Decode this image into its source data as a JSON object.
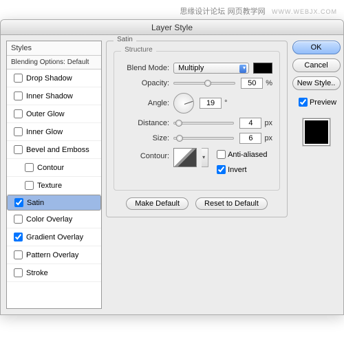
{
  "watermark": {
    "cn": "思缘设计论坛",
    "url": "WWW.WEBJX.COM",
    "site": "网页教学网"
  },
  "title": "Layer Style",
  "sidebar": {
    "header": "Styles",
    "subheader": "Blending Options: Default",
    "items": [
      {
        "label": "Drop Shadow",
        "checked": false,
        "indent": false,
        "selected": false
      },
      {
        "label": "Inner Shadow",
        "checked": false,
        "indent": false,
        "selected": false
      },
      {
        "label": "Outer Glow",
        "checked": false,
        "indent": false,
        "selected": false
      },
      {
        "label": "Inner Glow",
        "checked": false,
        "indent": false,
        "selected": false
      },
      {
        "label": "Bevel and Emboss",
        "checked": false,
        "indent": false,
        "selected": false
      },
      {
        "label": "Contour",
        "checked": false,
        "indent": true,
        "selected": false
      },
      {
        "label": "Texture",
        "checked": false,
        "indent": true,
        "selected": false
      },
      {
        "label": "Satin",
        "checked": true,
        "indent": false,
        "selected": true
      },
      {
        "label": "Color Overlay",
        "checked": false,
        "indent": false,
        "selected": false
      },
      {
        "label": "Gradient Overlay",
        "checked": true,
        "indent": false,
        "selected": false
      },
      {
        "label": "Pattern Overlay",
        "checked": false,
        "indent": false,
        "selected": false
      },
      {
        "label": "Stroke",
        "checked": false,
        "indent": false,
        "selected": false
      }
    ]
  },
  "panel": {
    "title": "Satin",
    "group": "Structure",
    "labels": {
      "blend": "Blend Mode:",
      "opacity": "Opacity:",
      "angle": "Angle:",
      "distance": "Distance:",
      "size": "Size:",
      "contour": "Contour:"
    },
    "blend_mode": "Multiply",
    "color": "#000000",
    "opacity": "50",
    "opacity_unit": "%",
    "angle": "19",
    "angle_unit": "°",
    "distance": "4",
    "distance_unit": "px",
    "size": "6",
    "size_unit": "px",
    "anti_aliased_label": "Anti-aliased",
    "anti_aliased": false,
    "invert_label": "Invert",
    "invert": true,
    "make_default": "Make Default",
    "reset_default": "Reset to Default"
  },
  "buttons": {
    "ok": "OK",
    "cancel": "Cancel",
    "new_style": "New Style..",
    "preview_label": "Preview",
    "preview": true
  }
}
